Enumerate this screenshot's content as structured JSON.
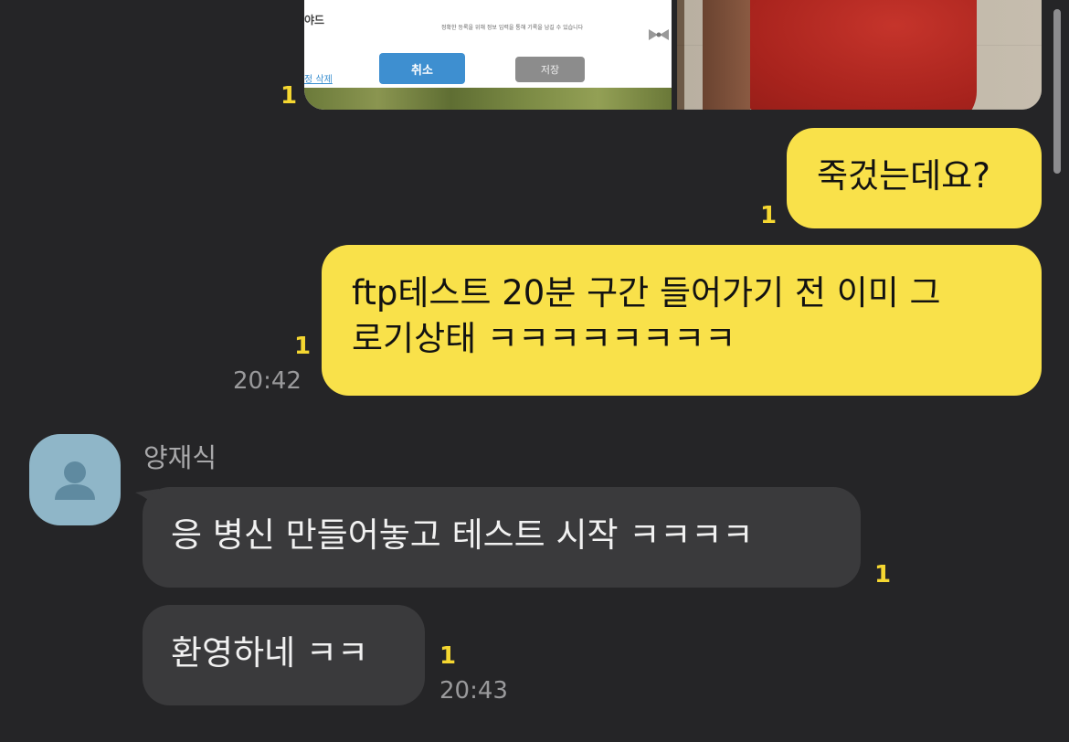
{
  "top_images": {
    "dialog": {
      "title_fragment": "야드",
      "note": "정확한 등록을 위해 정보 입력을 통해 기록을 남길 수 있습니다",
      "cancel_label": "취소",
      "save_label": "저장",
      "delete_link": "정 삭제"
    },
    "unread": "1"
  },
  "messages": [
    {
      "side": "me",
      "text": "죽겄는데요?",
      "unread": "1",
      "time": ""
    },
    {
      "side": "me",
      "text_line1": "ftp테스트 20분 구간 들어가기 전 이미 그",
      "text_line2": "로기상태 ㅋㅋㅋㅋㅋㅋㅋㅋ",
      "unread": "1",
      "time": "20:42"
    },
    {
      "side": "other",
      "sender": "양재식",
      "text": "응 병신 만들어놓고 테스트 시작 ㅋㅋㅋㅋ",
      "unread": "1",
      "time": ""
    },
    {
      "side": "other",
      "text": "환영하네 ㅋㅋ",
      "unread": "1",
      "time": "20:43"
    }
  ],
  "colors": {
    "background": "#252527",
    "my_bubble": "#f9e14a",
    "other_bubble": "#3a3a3c",
    "unread": "#f5d731",
    "avatar": "#8fb6c8"
  },
  "icons": {
    "avatar": "person-silhouette-icon"
  }
}
